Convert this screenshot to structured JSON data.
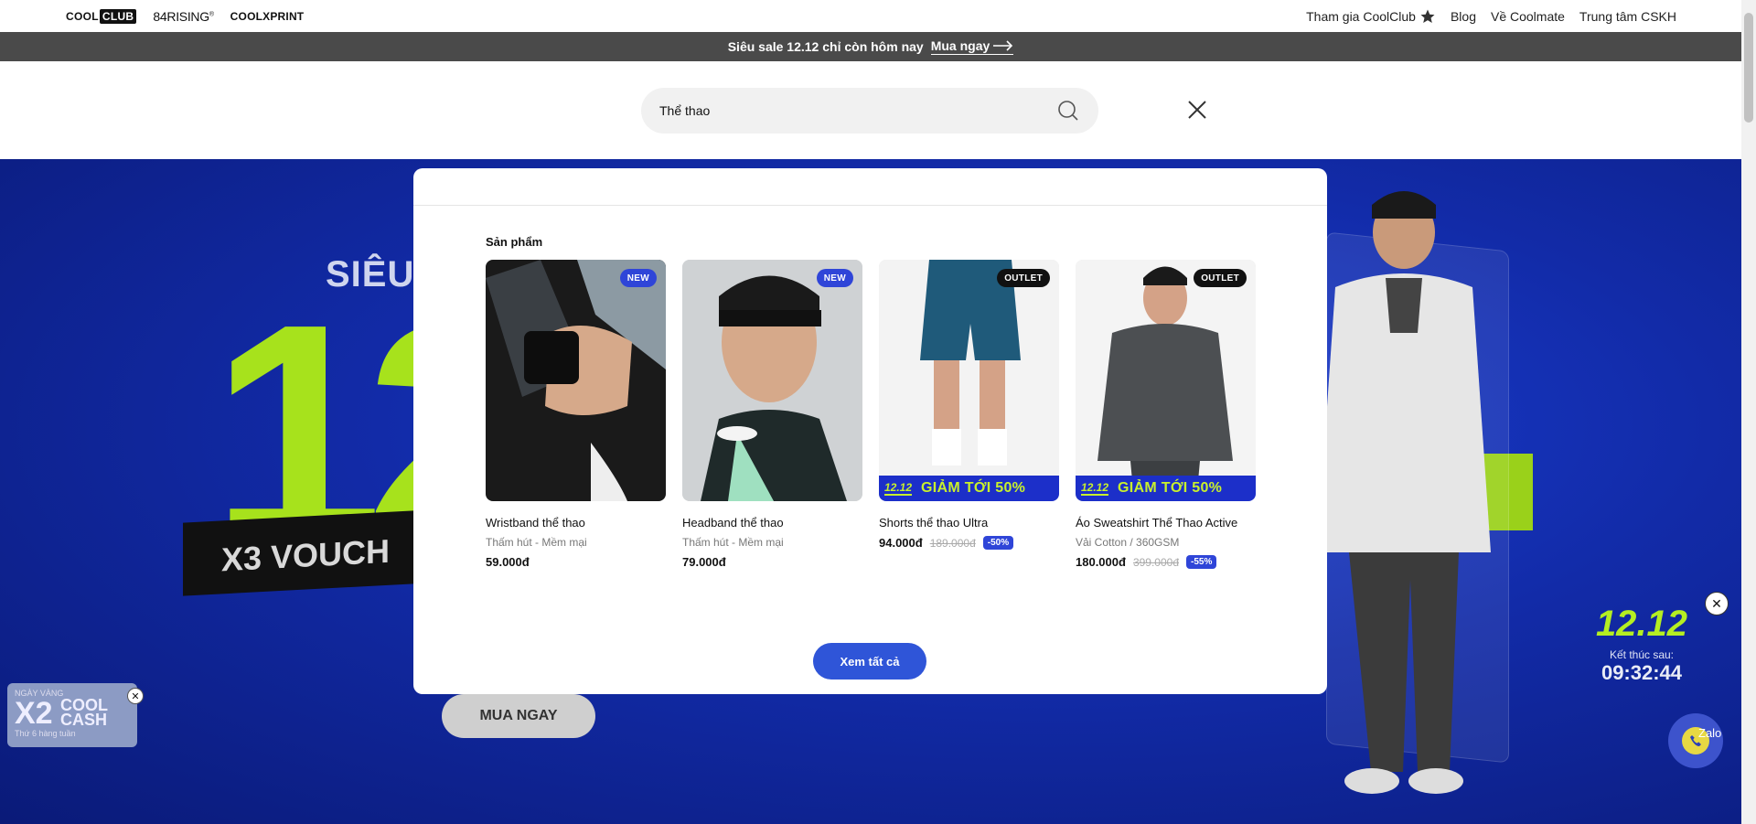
{
  "topbar": {
    "brands": {
      "coolclub_a": "COOL",
      "coolclub_b": "CLUB",
      "rising": "84RISING",
      "rising_sup": "®",
      "coolxprint": "COOLXPRINT"
    },
    "links": {
      "join": "Tham gia CoolClub",
      "blog": "Blog",
      "about": "Về Coolmate",
      "support": "Trung tâm CSKH"
    }
  },
  "promo": {
    "text": "Siêu sale 12.12 chỉ còn hôm nay",
    "cta": "Mua ngay"
  },
  "search": {
    "value": "Thể thao"
  },
  "hero": {
    "sieu": "SIÊU",
    "big": "12",
    "voucher": "X3 VOUCH",
    "cta": "MUA NGAY"
  },
  "modal": {
    "section_title": "Sản phẩm",
    "view_all": "Xem tất cả",
    "products": [
      {
        "name": "Wristband thể thao",
        "desc": "Thấm hút - Mềm mại",
        "price": "59.000đ",
        "old_price": "",
        "discount": "",
        "badge": "NEW"
      },
      {
        "name": "Headband thể thao",
        "desc": "Thấm hút - Mềm mại",
        "price": "79.000đ",
        "old_price": "",
        "discount": "",
        "badge": "NEW"
      },
      {
        "name": "Shorts thể thao Ultra",
        "desc": "",
        "price": "94.000đ",
        "old_price": "189.000đ",
        "discount": "-50%",
        "badge": "OUTLET",
        "sale_tag": "12.12",
        "sale_text": "GIẢM TỚI 50%"
      },
      {
        "name": "Áo Sweatshirt Thể Thao Active",
        "desc": "Vải Cotton / 360GSM",
        "price": "180.000đ",
        "old_price": "399.000đ",
        "discount": "-55%",
        "badge": "OUTLET",
        "sale_tag": "12.12",
        "sale_text": "GIẢM TỚI 50%"
      }
    ]
  },
  "widgets": {
    "cash": {
      "top": "NGÀY VÀNG",
      "x2": "X2",
      "cool": "COOL",
      "cash": "CASH",
      "week": "Thứ 6 hàng tuần"
    },
    "timer": {
      "num": "12.12",
      "label": "Kết thúc sau:",
      "time": "09:32:44"
    },
    "zalo": "Zalo"
  },
  "colors": {
    "accent": "#2f55d8",
    "hero": "#122ba8",
    "lime": "#a7e21c",
    "promo_bg": "#4a4a4a"
  }
}
